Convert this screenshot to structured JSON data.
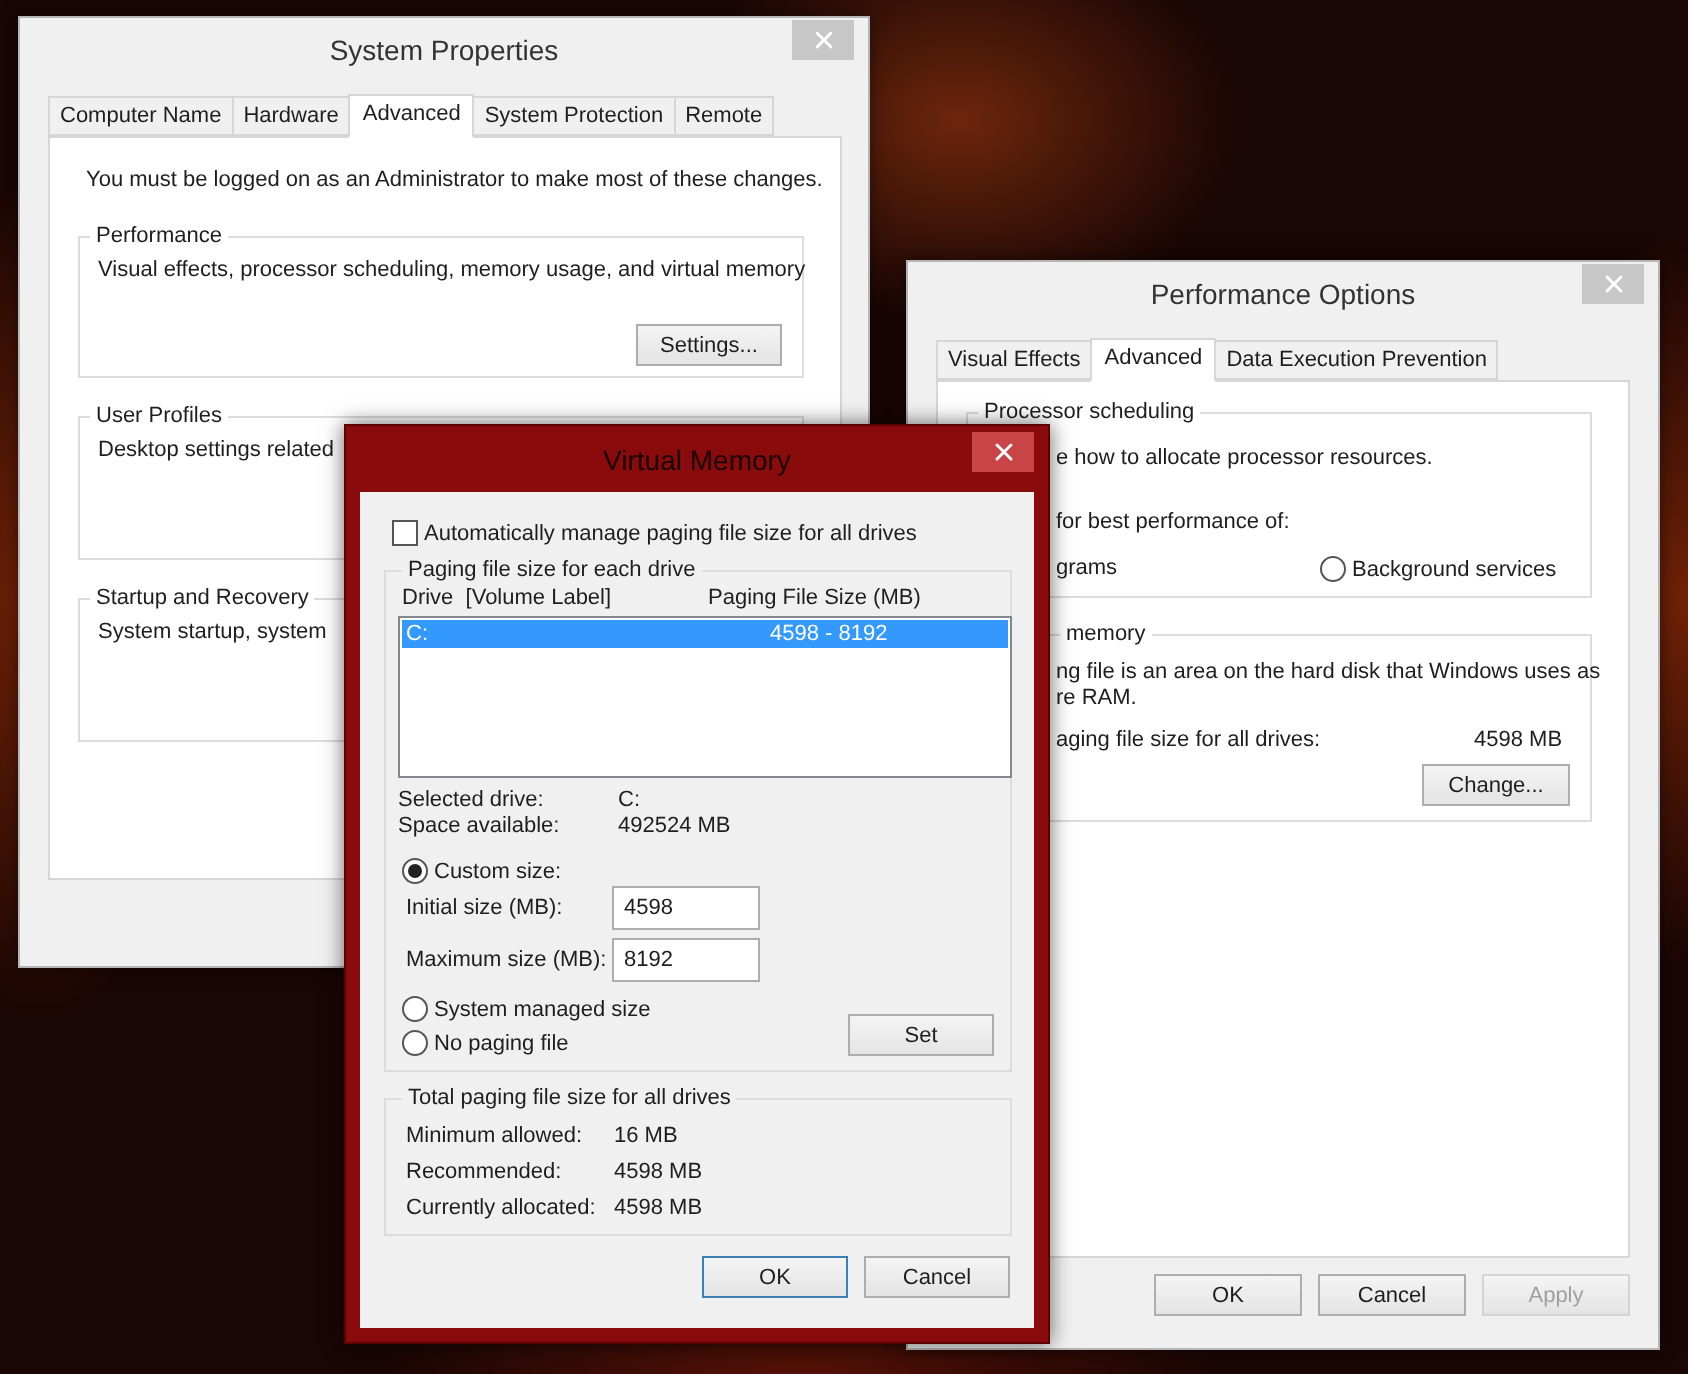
{
  "system_properties": {
    "title": "System Properties",
    "tabs": [
      {
        "label": "Computer Name",
        "selected": false
      },
      {
        "label": "Hardware",
        "selected": false
      },
      {
        "label": "Advanced",
        "selected": true
      },
      {
        "label": "System Protection",
        "selected": false
      },
      {
        "label": "Remote",
        "selected": false
      }
    ],
    "notice": "You must be logged on as an Administrator to make most of these changes.",
    "groups": [
      {
        "legend": "Performance",
        "text": "Visual effects, processor scheduling, memory usage, and virtual memory",
        "button": "Settings..."
      },
      {
        "legend": "User Profiles",
        "text": "Desktop settings related"
      },
      {
        "legend": "Startup and Recovery",
        "text": "System startup, system"
      }
    ]
  },
  "performance_options": {
    "title": "Performance Options",
    "tabs": [
      {
        "label": "Visual Effects",
        "selected": false
      },
      {
        "label": "Advanced",
        "selected": true
      },
      {
        "label": "Data Execution Prevention",
        "selected": false
      }
    ],
    "processor_scheduling": {
      "legend": "Processor scheduling",
      "text": "e how to allocate processor resources.",
      "prompt": "for best performance of:",
      "option_fragment": "grams",
      "radio": {
        "label": "Background services",
        "selected": false
      }
    },
    "virtual_memory": {
      "legend": "memory",
      "lines": [
        "ng file is an area on the hard disk that Windows uses as",
        "re RAM."
      ],
      "total_label": "aging file size for all drives:",
      "total_value": "4598 MB",
      "button": "Change..."
    },
    "buttons": [
      {
        "label": "OK",
        "disabled": false
      },
      {
        "label": "Cancel",
        "disabled": false
      },
      {
        "label": "Apply",
        "disabled": true
      }
    ]
  },
  "virtual_memory": {
    "title": "Virtual Memory",
    "auto_manage": {
      "label": "Automatically manage paging file size for all drives",
      "checked": false
    },
    "drives_group": {
      "legend": "Paging file size for each drive",
      "columns": [
        "Drive  [Volume Label]",
        "Paging File Size (MB)"
      ],
      "rows": [
        {
          "drive": "C:",
          "size": "4598 - 8192",
          "selected": true
        }
      ],
      "info": [
        {
          "label": "Selected drive:",
          "value": "C:"
        },
        {
          "label": "Space available:",
          "value": "492524 MB"
        }
      ],
      "radios": [
        {
          "label": "Custom size:",
          "selected": true
        },
        {
          "label": "System managed size",
          "selected": false
        },
        {
          "label": "No paging file",
          "selected": false
        }
      ],
      "fields": [
        {
          "label": "Initial size (MB):",
          "value": "4598"
        },
        {
          "label": "Maximum size (MB):",
          "value": "8192"
        }
      ],
      "set_button": "Set"
    },
    "totals_group": {
      "legend": "Total paging file size for all drives",
      "rows": [
        {
          "label": "Minimum allowed:",
          "value": "16 MB"
        },
        {
          "label": "Recommended:",
          "value": "4598 MB"
        },
        {
          "label": "Currently allocated:",
          "value": "4598 MB"
        }
      ]
    },
    "buttons": [
      {
        "label": "OK",
        "default": true
      },
      {
        "label": "Cancel",
        "default": false
      }
    ]
  }
}
